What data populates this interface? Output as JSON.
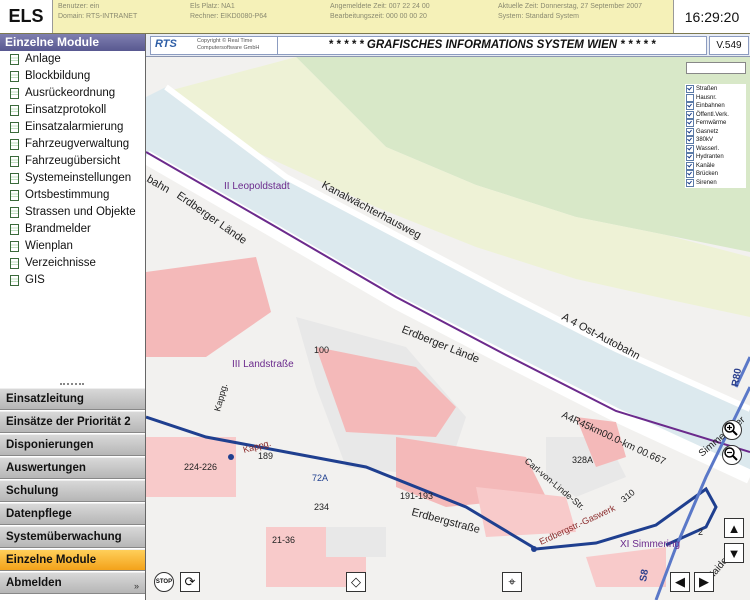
{
  "topbar": {
    "brand": "ELS",
    "clock": "16:29:20",
    "info": [
      {
        "a": "Benutzer: ein",
        "b": "Domain: RTS-INTRANET"
      },
      {
        "a": "Els Platz: NA1",
        "b": "Rechner: EIKD0080-P64"
      },
      {
        "a": "Angemeldete Zeit: 007 22 24 00",
        "b": "Bearbeitungszeit: 000 00 00 20"
      },
      {
        "a": "Aktuelle Zeit: Donnerstag, 27 September 2007",
        "b": "System: Standard System"
      }
    ]
  },
  "sidebar": {
    "header": "Einzelne Module",
    "modules": [
      "Anlage",
      "Blockbildung",
      "Ausrückeordnung",
      "Einsatzprotokoll",
      "Einsatzalarmierung",
      "Fahrzeugverwaltung",
      "Fahrzeugübersicht",
      "Systemeinstellungen",
      "Ortsbestimmung",
      "Strassen und Objekte",
      "Brandmelder",
      "Wienplan",
      "Verzeichnisse",
      "GIS"
    ],
    "nav": [
      {
        "label": "Einsatzleitung",
        "active": false
      },
      {
        "label": "Einsätze der Priorität 2",
        "active": false
      },
      {
        "label": "Disponierungen",
        "active": false
      },
      {
        "label": "Auswertungen",
        "active": false
      },
      {
        "label": "Schulung",
        "active": false
      },
      {
        "label": "Datenpflege",
        "active": false
      },
      {
        "label": "Systemüberwachung",
        "active": false
      },
      {
        "label": "Einzelne Module",
        "active": true
      },
      {
        "label": "Abmelden",
        "active": false
      }
    ]
  },
  "mapheader": {
    "logo": "RTS",
    "copyright1": "Copyright © Real Time",
    "copyright2": "Computersoftware GmbH",
    "title": "* * * * *   GRAFISCHES INFORMATIONS SYSTEM WIEN   * * * * *",
    "version": "V.549"
  },
  "layers": [
    {
      "name": "Straßen",
      "checked": true
    },
    {
      "name": "Hausnr.",
      "checked": false
    },
    {
      "name": "Einbahnen",
      "checked": true
    },
    {
      "name": "Öffentl.Verk.",
      "checked": true
    },
    {
      "name": "Fernwärme",
      "checked": true
    },
    {
      "name": "Gasnetz",
      "checked": true
    },
    {
      "name": "380kV",
      "checked": true
    },
    {
      "name": "Wasserl.",
      "checked": true
    },
    {
      "name": "Hydranten",
      "checked": true
    },
    {
      "name": "Kanäle",
      "checked": true
    },
    {
      "name": "Brücken",
      "checked": true
    },
    {
      "name": "Sirenen",
      "checked": true
    }
  ],
  "maplabels": {
    "district2": "II Leopoldstadt",
    "district3": "III Landstraße",
    "district11": "XI Simmering",
    "kanal": "Kanalwächterhausweg",
    "erdbergerlaende1": "Erdberger Lände",
    "erdbergerlaende2": "Erdberger Lände",
    "autobahn": "A 4 Ost-Autobahn",
    "a4r": "A4R45km00.0-km 00.667",
    "erdbergstrasse": "Erdbergstraße",
    "gaswerk": "Erdbergstr.-Gaswerk",
    "carl": "Carl-von-Linde-Str.",
    "kappg": "Kappg.",
    "kappg2": "Kappg.",
    "simmer": "Simmeringer",
    "haide": "1 Haide",
    "bahn": "bahn",
    "r80": "R80",
    "s8": "S8",
    "n100": "100",
    "n189": "189",
    "n234": "234",
    "n2136": "21-36",
    "n224": "224-226",
    "n191": "191-193",
    "n328a": "328A",
    "n72a": "72A",
    "n310": "310",
    "n2": "2"
  }
}
